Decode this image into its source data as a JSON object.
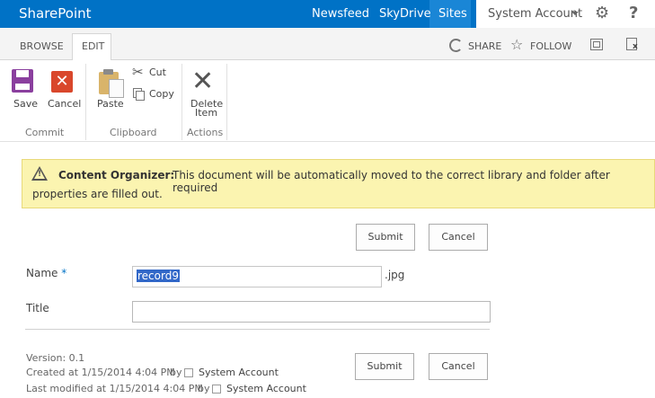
{
  "suite_bar": {
    "brand": "SharePoint",
    "links": [
      "Newsfeed",
      "SkyDrive",
      "Sites"
    ],
    "account": "System Account",
    "help": "?"
  },
  "tabs": {
    "browse": "BROWSE",
    "edit": "EDIT"
  },
  "page_actions": {
    "share": "SHARE",
    "follow": "FOLLOW"
  },
  "ribbon": {
    "save": "Save",
    "cancel": "Cancel",
    "paste": "Paste",
    "cut": "Cut",
    "copy": "Copy",
    "delete_line1": "Delete",
    "delete_line2": "Item",
    "groups": {
      "commit": "Commit",
      "clipboard": "Clipboard",
      "actions": "Actions"
    }
  },
  "notice": {
    "title": "Content Organizer:",
    "text_line1": "This document will be automatically moved to the correct library and folder after required",
    "text_line2": "properties are filled out."
  },
  "buttons": {
    "submit": "Submit",
    "cancel": "Cancel"
  },
  "form": {
    "name_label": "Name",
    "required_marker": "*",
    "name_value": "record9",
    "name_ext": ".jpg",
    "title_label": "Title",
    "title_value": ""
  },
  "metadata": {
    "version": "Version: 0.1",
    "created": "Created at 1/15/2014 4:04 PM",
    "created_by": "by",
    "created_user": "System Account",
    "modified": "Last modified at 1/15/2014 4:04 PM",
    "modified_by": "by",
    "modified_user": "System Account"
  },
  "colors": {
    "suite_blue": "#0072c6",
    "notice_yellow": "#fbf4b0"
  }
}
